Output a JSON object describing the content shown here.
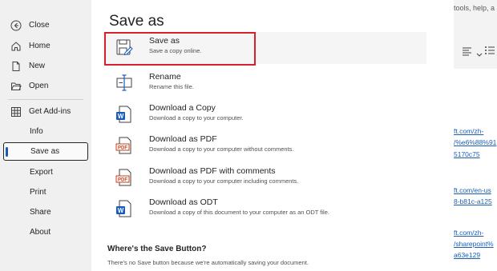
{
  "sidebar": {
    "items": [
      {
        "label": "Close",
        "icon": "back-arrow-icon"
      },
      {
        "label": "Home",
        "icon": "home-icon"
      },
      {
        "label": "New",
        "icon": "new-document-icon"
      },
      {
        "label": "Open",
        "icon": "folder-open-icon"
      },
      {
        "label": "Get Add-ins",
        "icon": "add-ins-grid-icon"
      },
      {
        "label": "Info"
      },
      {
        "label": "Save as"
      },
      {
        "label": "Export"
      },
      {
        "label": "Print"
      },
      {
        "label": "Share"
      },
      {
        "label": "About"
      }
    ],
    "selected": "Save as"
  },
  "main": {
    "title": "Save as",
    "options": [
      {
        "title": "Save as",
        "desc": "Save a copy online.",
        "icon": "save-as-icon"
      },
      {
        "title": "Rename",
        "desc": "Rename this file.",
        "icon": "rename-icon"
      },
      {
        "title": "Download a Copy",
        "desc": "Download a copy to your computer.",
        "icon": "word-doc-icon"
      },
      {
        "title": "Download as PDF",
        "desc": "Download a copy to your computer without comments.",
        "icon": "pdf-icon"
      },
      {
        "title": "Download as PDF with comments",
        "desc": "Download a copy to your computer including comments.",
        "icon": "pdf-icon"
      },
      {
        "title": "Download as ODT",
        "desc": "Download a copy of this document to your computer as an ODT file.",
        "icon": "odt-doc-icon"
      }
    ],
    "section_heading": "Where's the Save Button?",
    "section_text": "There's no Save button because we're automatically saving your document."
  },
  "background": {
    "search_text": "tools, help, a",
    "links": [
      "ft.com/zh-",
      "/%e6%88%91",
      "5170c75",
      "ft.com/en-us",
      "8-b81c-a125",
      "ft.com/zh-",
      "/sharepoint%",
      "a63e129"
    ]
  },
  "colors": {
    "accent": "#185abd",
    "focus": "#d7202f",
    "link": "#1a5fb4",
    "pdf": "#c43e1c",
    "word": "#185abd"
  }
}
